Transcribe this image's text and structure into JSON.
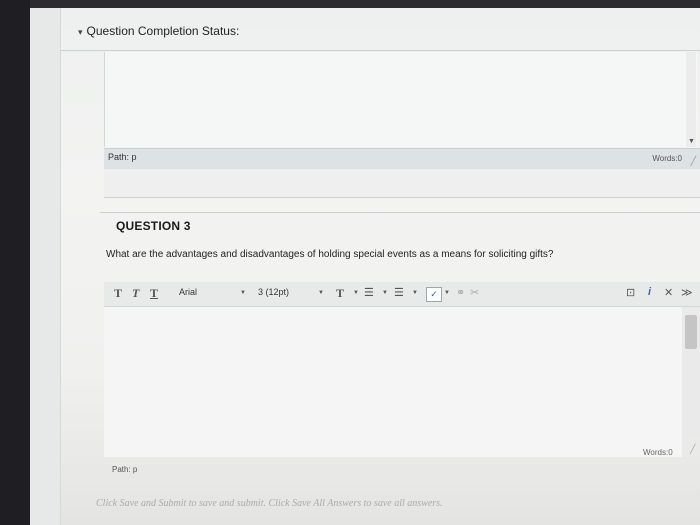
{
  "completion": {
    "title": "Question Completion Status:",
    "chevron": "chevron-down-icon"
  },
  "previous_editor": {
    "path": "Path: p",
    "words": "Words:0"
  },
  "question": {
    "title": "QUESTION 3",
    "text": "What are the advantages and disadvantages of holding special events as a means for soliciting gifts?"
  },
  "toolbar": {
    "format_t1": "T",
    "format_t2": "T",
    "format_t3": "T",
    "font_family": "Arial",
    "font_size": "3 (12pt)",
    "text_color_t": "T",
    "list_unordered": "☰",
    "list_ordered": "☰",
    "spellcheck": "✓",
    "link": "⚭",
    "right_icon1": "⊡",
    "right_icon2": "i",
    "right_icon3": "✕",
    "right_icon4": "≫"
  },
  "editor": {
    "words": "Words:0",
    "path": "Path: p"
  },
  "footer": {
    "text": "Click Save and Submit to save and submit. Click Save All Answers to save all answers."
  }
}
